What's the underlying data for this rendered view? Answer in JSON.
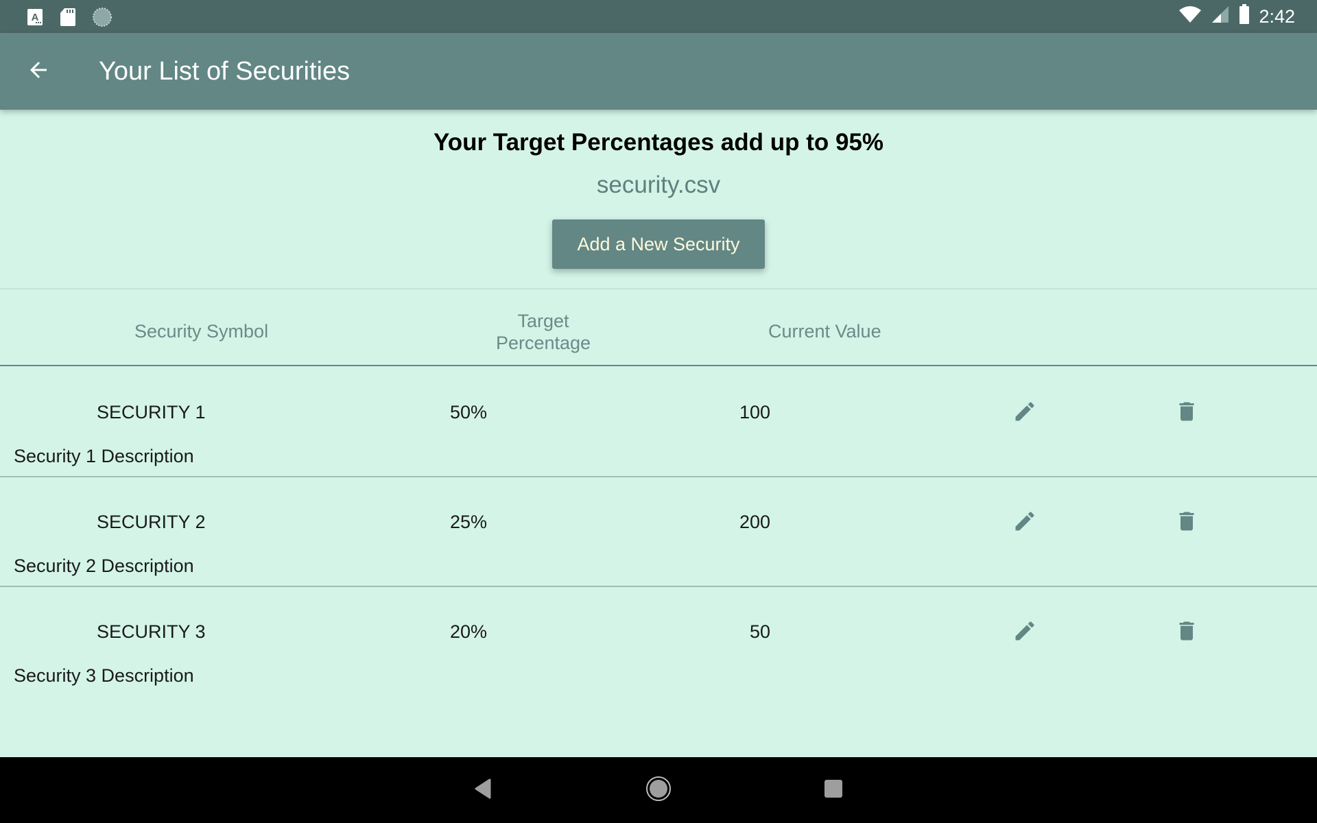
{
  "status_bar": {
    "left_icons": [
      "keyboard-a-icon",
      "sd-card-icon",
      "sync-spinner-icon"
    ],
    "right_icons": [
      "wifi-icon",
      "cell-signal-icon",
      "battery-icon"
    ],
    "time": "2:42"
  },
  "app_bar": {
    "back_icon": "arrow-back-icon",
    "title": "Your List of Securities"
  },
  "summary": {
    "text": "Your Target Percentages add up to 95%",
    "total_percentage": "95%",
    "filename": "security.csv",
    "add_button_label": "Add a New Security"
  },
  "table": {
    "headers": {
      "symbol": "Security Symbol",
      "target_line1": "Target",
      "target_line2": "Percentage",
      "value": "Current Value"
    },
    "rows": [
      {
        "symbol": "SECURITY 1",
        "description": "Security 1 Description",
        "target": "50%",
        "value": "100"
      },
      {
        "symbol": "SECURITY 2",
        "description": "Security 2 Description",
        "target": "25%",
        "value": "200"
      },
      {
        "symbol": "SECURITY 3",
        "description": "Security 3 Description",
        "target": "20%",
        "value": "50"
      }
    ],
    "row_action_icons": [
      "edit-icon",
      "delete-icon"
    ]
  },
  "nav_bar": {
    "buttons": [
      "back",
      "home",
      "recents"
    ]
  },
  "colors": {
    "status_bar": "#4b6866",
    "app_bar": "#628784",
    "background": "#d4f4e8",
    "accent": "#628784",
    "button_text": "#fff8dc",
    "header_text": "#6b8a88"
  }
}
